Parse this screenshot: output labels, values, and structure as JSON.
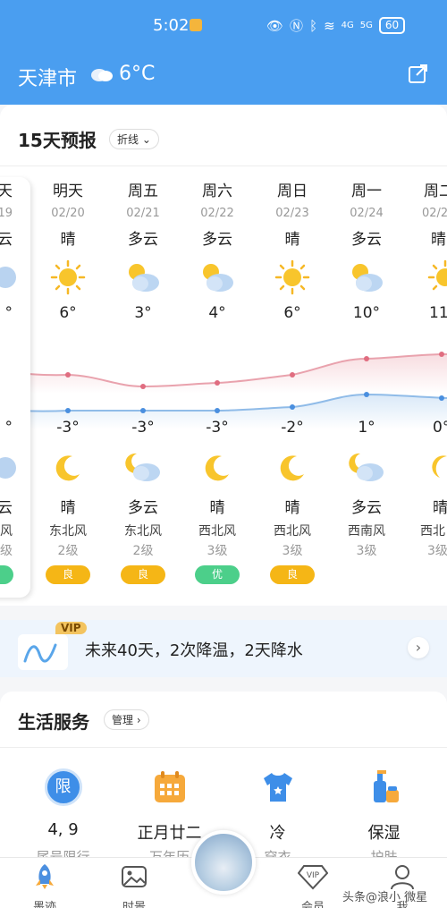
{
  "status_bar": {
    "time": "5:02",
    "icons": [
      "eye-icon",
      "nfc-icon",
      "bluetooth-icon",
      "wifi-icon",
      "4g-signal-icon",
      "5g-signal-icon"
    ],
    "net_4g": "4G",
    "net_5g": "5G",
    "battery": "60"
  },
  "header": {
    "city": "天津市",
    "temp": "6°C",
    "weather_icon": "cloud-icon",
    "share_icon": "share-icon"
  },
  "forecast": {
    "title": "15天预报",
    "mode_label": "折线",
    "columns": [
      {
        "day": "天",
        "date": "19",
        "day_weather": "云",
        "high": "°",
        "low": "°",
        "night_weather": "云",
        "wind_dir": "风",
        "wind_level": "级",
        "aqi": ""
      },
      {
        "day": "明天",
        "date": "02/20",
        "day_weather": "晴",
        "high": "6°",
        "low": "-3°",
        "night_weather": "晴",
        "wind_dir": "东北风",
        "wind_level": "2级",
        "aqi": "良"
      },
      {
        "day": "周五",
        "date": "02/21",
        "day_weather": "多云",
        "high": "3°",
        "low": "-3°",
        "night_weather": "多云",
        "wind_dir": "东北风",
        "wind_level": "2级",
        "aqi": "良"
      },
      {
        "day": "周六",
        "date": "02/22",
        "day_weather": "多云",
        "high": "4°",
        "low": "-3°",
        "night_weather": "晴",
        "wind_dir": "西北风",
        "wind_level": "3级",
        "aqi": "优"
      },
      {
        "day": "周日",
        "date": "02/23",
        "day_weather": "晴",
        "high": "6°",
        "low": "-2°",
        "night_weather": "晴",
        "wind_dir": "西北风",
        "wind_level": "3级",
        "aqi": "良"
      },
      {
        "day": "周一",
        "date": "02/24",
        "day_weather": "多云",
        "high": "10°",
        "low": "1°",
        "night_weather": "多云",
        "wind_dir": "西南风",
        "wind_level": "3级",
        "aqi": ""
      },
      {
        "day": "周二",
        "date": "02/2",
        "day_weather": "晴",
        "high": "11",
        "low": "0°",
        "night_weather": "晴",
        "wind_dir": "西北",
        "wind_level": "3级",
        "aqi": ""
      }
    ]
  },
  "vip": {
    "badge": "VIP",
    "text": "未来40天，2次降温，2天降水"
  },
  "life": {
    "title": "生活服务",
    "manage_label": "管理",
    "services": [
      {
        "icon": "traffic-limit-icon",
        "badge": "限",
        "value": "4, 9",
        "sub": "尾号限行"
      },
      {
        "icon": "calendar-icon",
        "value": "正月廿二",
        "sub": "万年历"
      },
      {
        "icon": "shirt-icon",
        "value": "冷",
        "sub": "穿衣"
      },
      {
        "icon": "skincare-icon",
        "value": "保湿",
        "sub": "护肤"
      }
    ]
  },
  "nav": {
    "items": [
      {
        "label": "墨迹",
        "icon": "rocket-icon"
      },
      {
        "label": "时景",
        "icon": "photo-icon"
      },
      {
        "label": "会员",
        "icon": "vip-diamond-icon"
      },
      {
        "label": "我",
        "icon": "user-icon"
      }
    ]
  },
  "watermark": "头条@浪小 微星"
}
